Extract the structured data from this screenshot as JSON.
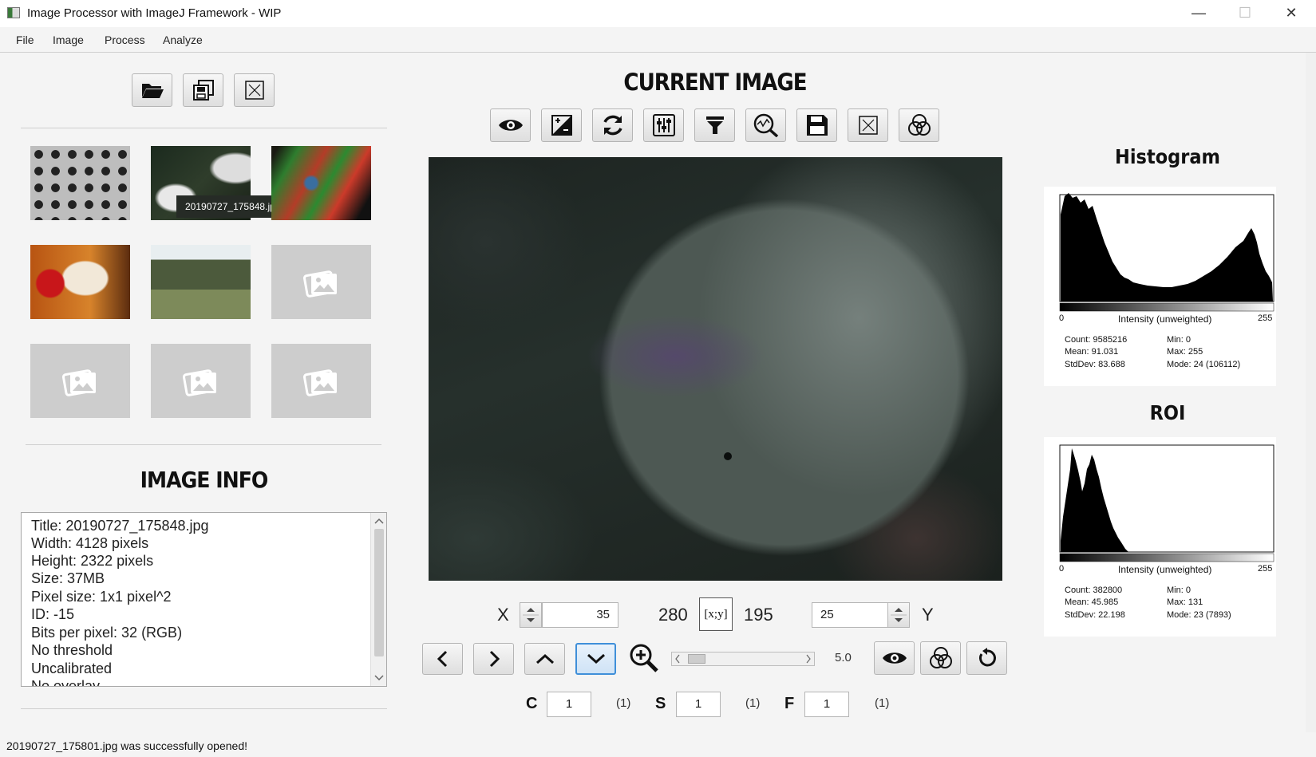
{
  "window": {
    "title": "Image Processor with ImageJ Framework - WIP",
    "minimize": "—",
    "maximize": "☐",
    "close": "✕"
  },
  "menu": {
    "items": [
      "File",
      "Image",
      "Process",
      "Analyze"
    ]
  },
  "left": {
    "thumbnail_tooltip": "20190727_175848.jpg",
    "info_title": "IMAGE INFO",
    "info_lines": [
      "Title: 20190727_175848.jpg",
      "Width:  4128 pixels",
      "Height:  2322 pixels",
      "Size:  37MB",
      "Pixel size: 1x1 pixel^2",
      "ID: -15",
      "Bits per pixel: 32 (RGB)",
      "No threshold",
      "Uncalibrated",
      "No overlay"
    ]
  },
  "center": {
    "title": "CURRENT IMAGE",
    "toolbar_icons": [
      "eye-icon",
      "contrast-icon",
      "refresh-icon",
      "sliders-icon",
      "filter-icon",
      "analyze-icon",
      "save-icon",
      "close-image-icon",
      "channels-icon"
    ],
    "x_label": "X",
    "x_value": "35",
    "coord_x": "280",
    "coord_button": "[x;y]",
    "coord_y": "195",
    "y_value": "25",
    "y_label": "Y",
    "zoom_value": "5.0",
    "c_label": "C",
    "c_value": "1",
    "c_count": "(1)",
    "s_label": "S",
    "s_value": "1",
    "s_count": "(1)",
    "f_label": "F",
    "f_value": "1",
    "f_count": "(1)"
  },
  "right": {
    "histogram_title": "Histogram",
    "histogram": {
      "axis_min": "0",
      "axis_label": "Intensity (unweighted)",
      "axis_max": "255",
      "count": "Count: 9585216",
      "mean": "Mean: 91.031",
      "stddev": "StdDev: 83.688",
      "min": "Min: 0",
      "max": "Max: 255",
      "mode": "Mode: 24 (106112)"
    },
    "roi_title": "ROI",
    "roi": {
      "axis_min": "0",
      "axis_label": "Intensity (unweighted)",
      "axis_max": "255",
      "count": "Count: 382800",
      "mean": "Mean: 45.985",
      "stddev": "StdDev: 22.198",
      "min": "Min: 0",
      "max": "Max: 131",
      "mode": "Mode: 23 (7893)"
    }
  },
  "status": {
    "message": "20190727_175801.jpg was successfully opened!"
  }
}
